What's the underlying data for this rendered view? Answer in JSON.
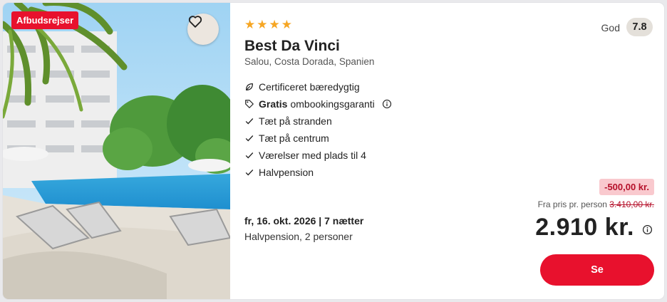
{
  "card": {
    "badge": "Afbudsrejser",
    "favorite_icon": "heart-icon",
    "stars": 4,
    "hotel_name": "Best Da Vinci",
    "location": "Salou, Costa Dorada, Spanien",
    "rating_label": "God",
    "rating_value": "7.8",
    "features": [
      {
        "icon": "leaf-icon",
        "bold": "",
        "text": "Certificeret bæredygtig"
      },
      {
        "icon": "tag-icon",
        "bold": "Gratis",
        "text": "ombookingsgaranti",
        "info": true
      },
      {
        "icon": "check-icon",
        "bold": "",
        "text": "Tæt på stranden"
      },
      {
        "icon": "check-icon",
        "bold": "",
        "text": "Tæt på centrum"
      },
      {
        "icon": "check-icon",
        "bold": "",
        "text": "Værelser med plads til 4"
      },
      {
        "icon": "check-icon",
        "bold": "",
        "text": "Halvpension"
      }
    ],
    "date": "fr, 16. okt. 2026 | 7 nætter",
    "board_and_guests": "Halvpension, 2 personer",
    "discount": "-500,00 kr.",
    "from_price_label": "Fra pris pr. person",
    "old_price": "3.410,00 kr.",
    "price": "2.910 kr.",
    "cta_label": "Se"
  },
  "colors": {
    "accent": "#e8112d",
    "star": "#f6a623",
    "discount_bg": "#f9c9ce",
    "discount_text": "#b5102a"
  }
}
